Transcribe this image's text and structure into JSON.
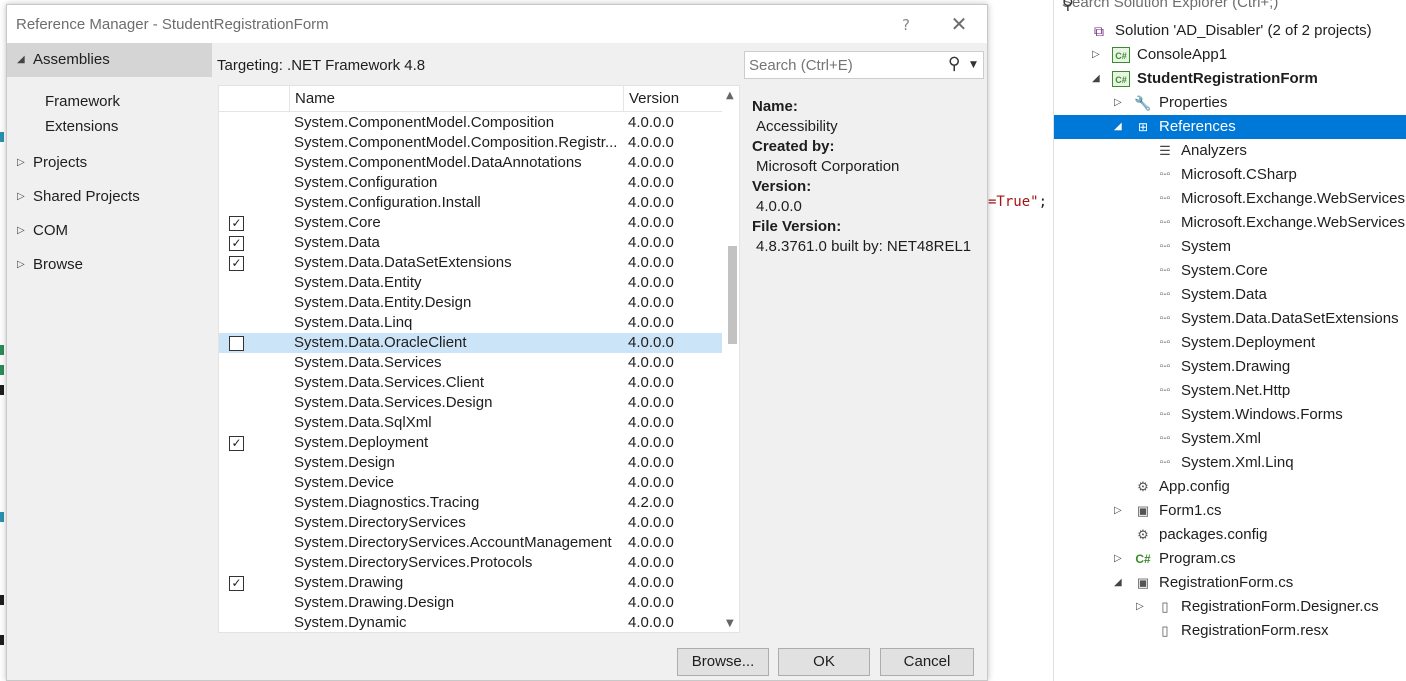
{
  "dialog": {
    "title": "Reference Manager - StudentRegistrationForm",
    "help": "?",
    "close": "✕"
  },
  "nav": {
    "assemblies": "Assemblies",
    "framework": "Framework",
    "extensions": "Extensions",
    "projects": "Projects",
    "shared_projects": "Shared Projects",
    "com": "COM",
    "browse": "Browse"
  },
  "content": {
    "targeting": "Targeting: .NET Framework 4.8",
    "col_name": "Name",
    "col_version": "Version",
    "rows": [
      {
        "name": "System.ComponentModel.Composition",
        "version": "4.0.0.0",
        "checked": "none"
      },
      {
        "name": "System.ComponentModel.Composition.Registr...",
        "version": "4.0.0.0",
        "checked": "none"
      },
      {
        "name": "System.ComponentModel.DataAnnotations",
        "version": "4.0.0.0",
        "checked": "none"
      },
      {
        "name": "System.Configuration",
        "version": "4.0.0.0",
        "checked": "none"
      },
      {
        "name": "System.Configuration.Install",
        "version": "4.0.0.0",
        "checked": "none"
      },
      {
        "name": "System.Core",
        "version": "4.0.0.0",
        "checked": "yes"
      },
      {
        "name": "System.Data",
        "version": "4.0.0.0",
        "checked": "yes"
      },
      {
        "name": "System.Data.DataSetExtensions",
        "version": "4.0.0.0",
        "checked": "yes"
      },
      {
        "name": "System.Data.Entity",
        "version": "4.0.0.0",
        "checked": "none"
      },
      {
        "name": "System.Data.Entity.Design",
        "version": "4.0.0.0",
        "checked": "none"
      },
      {
        "name": "System.Data.Linq",
        "version": "4.0.0.0",
        "checked": "none"
      },
      {
        "name": "System.Data.OracleClient",
        "version": "4.0.0.0",
        "checked": "empty",
        "selected": true
      },
      {
        "name": "System.Data.Services",
        "version": "4.0.0.0",
        "checked": "none"
      },
      {
        "name": "System.Data.Services.Client",
        "version": "4.0.0.0",
        "checked": "none"
      },
      {
        "name": "System.Data.Services.Design",
        "version": "4.0.0.0",
        "checked": "none"
      },
      {
        "name": "System.Data.SqlXml",
        "version": "4.0.0.0",
        "checked": "none"
      },
      {
        "name": "System.Deployment",
        "version": "4.0.0.0",
        "checked": "yes"
      },
      {
        "name": "System.Design",
        "version": "4.0.0.0",
        "checked": "none"
      },
      {
        "name": "System.Device",
        "version": "4.0.0.0",
        "checked": "none"
      },
      {
        "name": "System.Diagnostics.Tracing",
        "version": "4.2.0.0",
        "checked": "none"
      },
      {
        "name": "System.DirectoryServices",
        "version": "4.0.0.0",
        "checked": "none"
      },
      {
        "name": "System.DirectoryServices.AccountManagement",
        "version": "4.0.0.0",
        "checked": "none"
      },
      {
        "name": "System.DirectoryServices.Protocols",
        "version": "4.0.0.0",
        "checked": "none"
      },
      {
        "name": "System.Drawing",
        "version": "4.0.0.0",
        "checked": "yes"
      },
      {
        "name": "System.Drawing.Design",
        "version": "4.0.0.0",
        "checked": "none"
      },
      {
        "name": "System.Dynamic",
        "version": "4.0.0.0",
        "checked": "none"
      }
    ]
  },
  "search": {
    "placeholder": "Search (Ctrl+E)"
  },
  "details": {
    "name_label": "Name:",
    "name_value": "Accessibility",
    "created_label": "Created by:",
    "created_value": "Microsoft Corporation",
    "version_label": "Version:",
    "version_value": "4.0.0.0",
    "file_version_label": "File Version:",
    "file_version_value": "4.8.3761.0 built by: NET48REL1"
  },
  "buttons": {
    "browse": "Browse...",
    "ok": "OK",
    "cancel": "Cancel"
  },
  "editor": {
    "fragment": "=True\"",
    "semicolon": ";"
  },
  "solution_explorer": {
    "search_placeholder": "Search Solution Explorer (Ctrl+;)",
    "items": [
      {
        "label": "Solution 'AD_Disabler' (2 of 2 projects)",
        "icon": "solution-icon",
        "glyph": "⧉",
        "depth": 0,
        "arrow": ""
      },
      {
        "label": "ConsoleApp1",
        "icon": "csharp-project-icon",
        "glyph": "C#",
        "depth": 1,
        "arrow": "▷"
      },
      {
        "label": "StudentRegistrationForm",
        "icon": "csharp-project-icon",
        "glyph": "C#",
        "depth": 1,
        "arrow": "◢",
        "bold": true
      },
      {
        "label": "Properties",
        "icon": "wrench-icon",
        "glyph": "🔧",
        "depth": 2,
        "arrow": "▷"
      },
      {
        "label": "References",
        "icon": "references-icon",
        "glyph": "⊞",
        "depth": 2,
        "arrow": "◢",
        "selected": true
      },
      {
        "label": "Analyzers",
        "icon": "analyzer-icon",
        "glyph": "☰",
        "depth": 3,
        "arrow": ""
      },
      {
        "label": "Microsoft.CSharp",
        "icon": "reference-icon",
        "glyph": "▫-▫",
        "depth": 3,
        "arrow": ""
      },
      {
        "label": "Microsoft.Exchange.WebServices",
        "icon": "reference-icon",
        "glyph": "▫-▫",
        "depth": 3,
        "arrow": ""
      },
      {
        "label": "Microsoft.Exchange.WebServices.Aut",
        "icon": "reference-icon",
        "glyph": "▫-▫",
        "depth": 3,
        "arrow": ""
      },
      {
        "label": "System",
        "icon": "reference-icon",
        "glyph": "▫-▫",
        "depth": 3,
        "arrow": ""
      },
      {
        "label": "System.Core",
        "icon": "reference-icon",
        "glyph": "▫-▫",
        "depth": 3,
        "arrow": ""
      },
      {
        "label": "System.Data",
        "icon": "reference-icon",
        "glyph": "▫-▫",
        "depth": 3,
        "arrow": ""
      },
      {
        "label": "System.Data.DataSetExtensions",
        "icon": "reference-icon",
        "glyph": "▫-▫",
        "depth": 3,
        "arrow": ""
      },
      {
        "label": "System.Deployment",
        "icon": "reference-icon",
        "glyph": "▫-▫",
        "depth": 3,
        "arrow": ""
      },
      {
        "label": "System.Drawing",
        "icon": "reference-icon",
        "glyph": "▫-▫",
        "depth": 3,
        "arrow": ""
      },
      {
        "label": "System.Net.Http",
        "icon": "reference-icon",
        "glyph": "▫-▫",
        "depth": 3,
        "arrow": ""
      },
      {
        "label": "System.Windows.Forms",
        "icon": "reference-icon",
        "glyph": "▫-▫",
        "depth": 3,
        "arrow": ""
      },
      {
        "label": "System.Xml",
        "icon": "reference-icon",
        "glyph": "▫-▫",
        "depth": 3,
        "arrow": ""
      },
      {
        "label": "System.Xml.Linq",
        "icon": "reference-icon",
        "glyph": "▫-▫",
        "depth": 3,
        "arrow": ""
      },
      {
        "label": "App.config",
        "icon": "config-icon",
        "glyph": "⚙",
        "depth": 2,
        "arrow": ""
      },
      {
        "label": "Form1.cs",
        "icon": "form-icon",
        "glyph": "▣",
        "depth": 2,
        "arrow": "▷"
      },
      {
        "label": "packages.config",
        "icon": "config-icon",
        "glyph": "⚙",
        "depth": 2,
        "arrow": ""
      },
      {
        "label": "Program.cs",
        "icon": "csharp-file-icon",
        "glyph": "C#",
        "depth": 2,
        "arrow": "▷"
      },
      {
        "label": "RegistrationForm.cs",
        "icon": "form-icon",
        "glyph": "▣",
        "depth": 2,
        "arrow": "◢"
      },
      {
        "label": "RegistrationForm.Designer.cs",
        "icon": "file-icon",
        "glyph": "▯",
        "depth": 3,
        "arrow": "▷"
      },
      {
        "label": "RegistrationForm.resx",
        "icon": "file-icon",
        "glyph": "▯",
        "depth": 3,
        "arrow": ""
      }
    ]
  }
}
